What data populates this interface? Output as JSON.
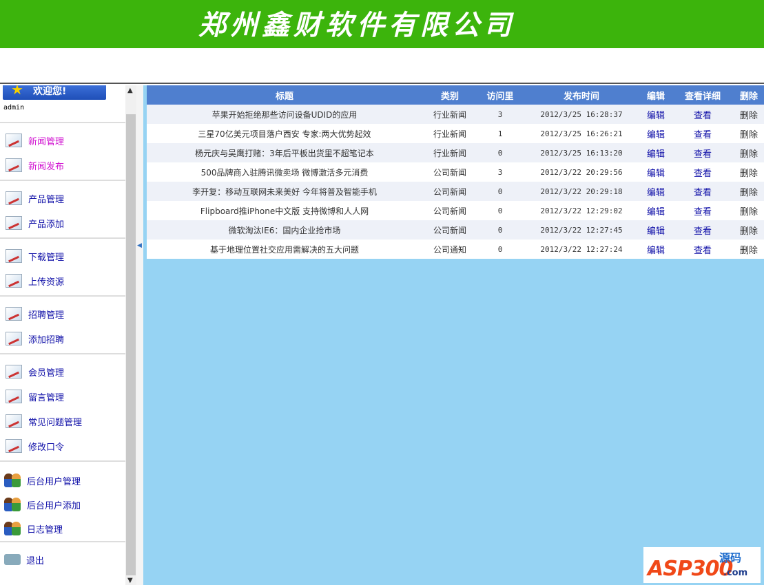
{
  "header": {
    "title": "郑州鑫财软件有限公司"
  },
  "sidebar": {
    "welcome": "欢迎您!",
    "user": "admin",
    "groups": [
      [
        {
          "label": "新闻管理",
          "icon": "edit-doc-icon"
        },
        {
          "label": "新闻发布",
          "icon": "edit-doc-icon"
        }
      ],
      [
        {
          "label": "产品管理",
          "icon": "edit-doc-icon"
        },
        {
          "label": "产品添加",
          "icon": "edit-doc-icon"
        }
      ],
      [
        {
          "label": "下载管理",
          "icon": "edit-doc-icon"
        },
        {
          "label": "上传资源",
          "icon": "edit-doc-icon"
        }
      ],
      [
        {
          "label": "招聘管理",
          "icon": "edit-doc-icon"
        },
        {
          "label": "添加招聘",
          "icon": "edit-doc-icon"
        }
      ],
      [
        {
          "label": "会员管理",
          "icon": "edit-doc-icon"
        },
        {
          "label": "留言管理",
          "icon": "edit-doc-icon"
        },
        {
          "label": "常见问题管理",
          "icon": "edit-doc-icon"
        },
        {
          "label": "修改口令",
          "icon": "edit-doc-icon"
        }
      ],
      [
        {
          "label": "后台用户管理",
          "icon": "users-icon"
        },
        {
          "label": "后台用户添加",
          "icon": "users-icon"
        },
        {
          "label": "日志管理",
          "icon": "users-icon"
        }
      ],
      [
        {
          "label": "退出",
          "icon": "exit-icon"
        }
      ]
    ]
  },
  "table": {
    "headers": [
      "标题",
      "类别",
      "访问里",
      "发布时间",
      "编辑",
      "查看详细",
      "删除"
    ],
    "rows": [
      [
        "苹果开始拒绝那些访问设备UDID的应用",
        "行业新闻",
        "3",
        "2012/3/25 16:28:37",
        "编辑",
        "查看",
        "删除"
      ],
      [
        "三星70亿美元项目落户西安 专家:两大优势起效",
        "行业新闻",
        "1",
        "2012/3/25 16:26:21",
        "编辑",
        "查看",
        "删除"
      ],
      [
        "杨元庆与吴鹰打赌：3年后平板出货里不超笔记本",
        "行业新闻",
        "0",
        "2012/3/25 16:13:20",
        "编辑",
        "查看",
        "删除"
      ],
      [
        "500品牌商入驻腾讯微卖场 微博激活多元消费",
        "公司新闻",
        "3",
        "2012/3/22 20:29:56",
        "编辑",
        "查看",
        "删除"
      ],
      [
        "李开复：移动互联网未来美好 今年将普及智能手机",
        "公司新闻",
        "0",
        "2012/3/22 20:29:18",
        "编辑",
        "查看",
        "删除"
      ],
      [
        "Flipboard推iPhone中文版 支持微博和人人网",
        "公司新闻",
        "0",
        "2012/3/22 12:29:02",
        "编辑",
        "查看",
        "删除"
      ],
      [
        "微软淘汰IE6：国内企业抢市场",
        "公司新闻",
        "0",
        "2012/3/22 12:27:45",
        "编辑",
        "查看",
        "删除"
      ],
      [
        "基于地理位置社交应用需解决的五大问题",
        "公司通知",
        "0",
        "2012/3/22 12:27:24",
        "编辑",
        "查看",
        "删除"
      ]
    ]
  },
  "watermark": {
    "brand": "ASP300",
    "suffix1": "源码",
    "suffix2": ".com"
  }
}
